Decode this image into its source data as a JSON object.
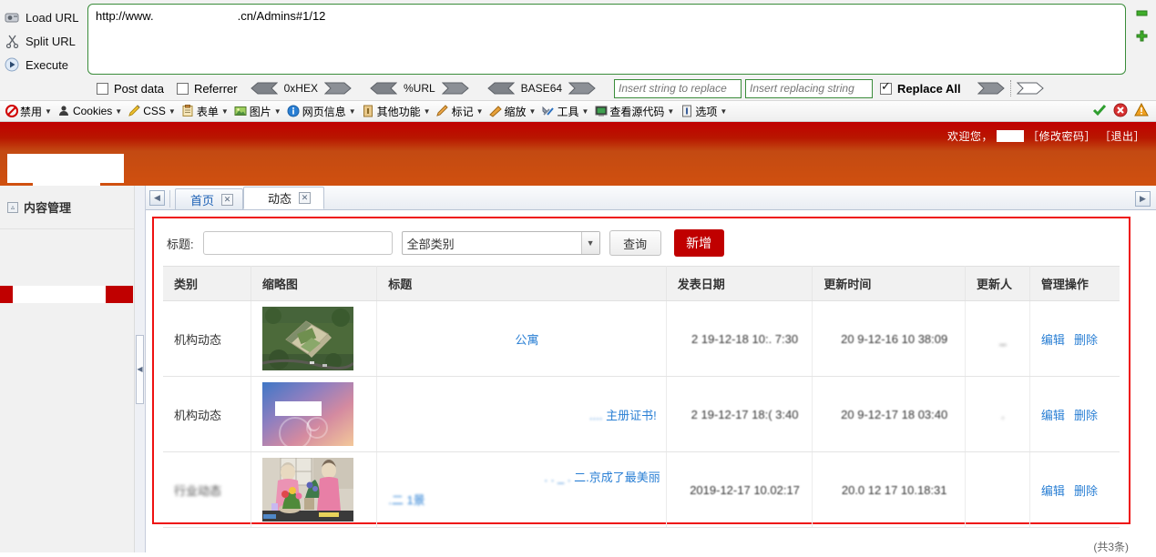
{
  "http_tool": {
    "commands": [
      {
        "label": "Load URL",
        "icon": "load-url-icon",
        "accesskey": "a"
      },
      {
        "label": "Split URL",
        "icon": "split-url-icon",
        "accesskey": "S"
      },
      {
        "label": "Execute",
        "icon": "execute-icon",
        "accesskey": "x"
      }
    ],
    "url_prefix": "http://www.",
    "url_suffix": ".cn/Admins#1/12",
    "options": {
      "post_data": "Post data",
      "referrer": "Referrer",
      "hex": "0xHEX",
      "url_encode": "%URL",
      "base64": "BASE64",
      "replace_all": "Replace All",
      "post_data_checked": false,
      "referrer_checked": false,
      "replace_all_checked": true
    },
    "find_placeholder": "Insert string to replace",
    "replace_placeholder": "Insert replacing string",
    "plus_label": "+",
    "minus_label": "−"
  },
  "menubar": {
    "items": [
      {
        "label": "禁用",
        "icon": "disable-icon"
      },
      {
        "label": "Cookies",
        "icon": "cookie-icon"
      },
      {
        "label": "CSS",
        "icon": "css-icon"
      },
      {
        "label": "表单",
        "icon": "form-icon"
      },
      {
        "label": "图片",
        "icon": "image-icon"
      },
      {
        "label": "网页信息",
        "icon": "info-icon"
      },
      {
        "label": "其他功能",
        "icon": "misc-icon"
      },
      {
        "label": "标记",
        "icon": "outline-icon"
      },
      {
        "label": "缩放",
        "icon": "resize-icon"
      },
      {
        "label": "工具",
        "icon": "tools-icon"
      },
      {
        "label": "查看源代码",
        "icon": "view-source-icon"
      },
      {
        "label": "选项",
        "icon": "options-icon"
      }
    ],
    "status_icons": [
      "check-icon",
      "error-icon",
      "warning-icon"
    ]
  },
  "site_header": {
    "welcome_text": "欢迎您，",
    "username_redacted": "",
    "change_password": "［修改密码］",
    "logout": "［退出］"
  },
  "sidebar": {
    "group_label": "内容管理",
    "group_icon": "collapse-square-icon"
  },
  "tabs": {
    "scroll_left": "◀",
    "scroll_right": "▶",
    "items": [
      {
        "label": "首页",
        "active": false,
        "close": "✕"
      },
      {
        "label": "动态",
        "active": true,
        "close": "✕"
      }
    ]
  },
  "search_form": {
    "title_label": "标题:",
    "title_value": "",
    "title_placeholder": "",
    "category_selected": "全部类别",
    "category_options": [
      "全部类别"
    ],
    "query_button": "查询",
    "add_button": "新增"
  },
  "grid": {
    "columns": [
      "类别",
      "缩略图",
      "标题",
      "发表日期",
      "更新时间",
      "更新人",
      "管理操作"
    ],
    "rows": [
      {
        "category": "机构动态",
        "thumb": "aerial-campus-photo",
        "title": "公寓",
        "title_blurred_prefix": "",
        "published": "2 19-12-18 10:. 7:30",
        "updated": "20  9-12-16 10 38:09",
        "updater": "_",
        "edit": "编辑",
        "delete": "删除"
      },
      {
        "category": "机构动态",
        "thumb": "gradient-certificate-photo",
        "title": "主册证书!",
        "title_blurred_prefix": "....",
        "published": "2 19-12-17 18:( 3:40",
        "updated": "20  9-12-17 18 03:40",
        "updater": ".",
        "edit": "编辑",
        "delete": "删除"
      },
      {
        "category": "行业动态",
        "thumb": "two-women-flowers-photo",
        "title": "二.京成了最美丽",
        "title_line2": ".二 1景",
        "title_blurred_prefix": ".                .              _          .",
        "published": "2019-12-17 10.02:17",
        "updated": "20.0 12 17 10.18:31",
        "updater": "",
        "edit": "编辑",
        "delete": "删除"
      }
    ]
  },
  "footer": {
    "total_text": "(共3条)"
  }
}
